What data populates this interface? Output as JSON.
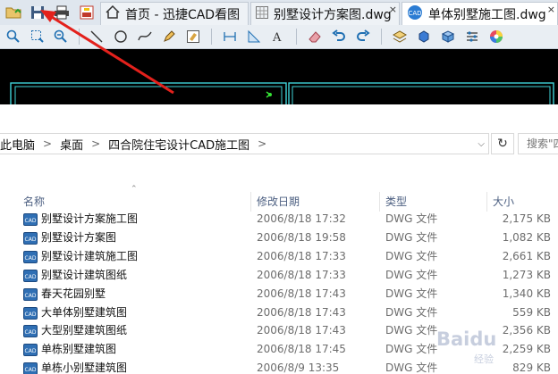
{
  "cad": {
    "tabs": [
      {
        "label": "首页 - 迅捷CAD看图",
        "icon": "home-icon",
        "close": ""
      },
      {
        "label": "别墅设计方案图.dwg",
        "icon": "drawing-grid-icon",
        "close": "×"
      },
      {
        "label": "单体别墅施工图.dwg",
        "icon": "cad-file-icon",
        "close": "×"
      }
    ],
    "quick_buttons": [
      "open-file-icon",
      "save-icon",
      "print-icon",
      "export-pdf-icon"
    ],
    "tools": [
      "zoom-in-icon",
      "zoom-window-icon",
      "zoom-extents-icon",
      "line-icon",
      "circle-icon",
      "spline-icon",
      "pencil-icon",
      "text-edit-icon",
      "dimension-icon",
      "area-measure-icon",
      "text-style-icon",
      "eraser-icon",
      "undo-icon",
      "redo-icon",
      "layer-icon",
      "3d-view-icon",
      "block-icon",
      "properties-icon",
      "color-wheel-icon"
    ]
  },
  "explorer": {
    "breadcrumb": [
      "此电脑",
      "桌面",
      "四合院住宅设计CAD施工图"
    ],
    "search_placeholder": "搜索\"四",
    "columns": {
      "name": "名称",
      "date": "修改日期",
      "type": "类型",
      "size": "大小"
    },
    "files": [
      {
        "name": "别墅设计方案施工图",
        "date": "2006/8/18 17:32",
        "type": "DWG 文件",
        "size": "2,175 KB"
      },
      {
        "name": "别墅设计方案图",
        "date": "2006/8/18 19:58",
        "type": "DWG 文件",
        "size": "1,082 KB"
      },
      {
        "name": "别墅设计建筑施工图",
        "date": "2006/8/18 17:33",
        "type": "DWG 文件",
        "size": "2,661 KB"
      },
      {
        "name": "别墅设计建筑图纸",
        "date": "2006/8/18 17:33",
        "type": "DWG 文件",
        "size": "1,273 KB"
      },
      {
        "name": "春天花园别墅",
        "date": "2006/8/18 17:43",
        "type": "DWG 文件",
        "size": "1,340 KB"
      },
      {
        "name": "大单体别墅建筑图",
        "date": "2006/8/18 17:43",
        "type": "DWG 文件",
        "size": "559 KB"
      },
      {
        "name": "大型别墅建筑图纸",
        "date": "2006/8/18 17:43",
        "type": "DWG 文件",
        "size": "2,356 KB"
      },
      {
        "name": "单栋别墅建筑图",
        "date": "2006/8/18 17:45",
        "type": "DWG 文件",
        "size": "2,259 KB"
      },
      {
        "name": "单栋小别墅建筑图",
        "date": "2006/8/9 13:35",
        "type": "DWG 文件",
        "size": "829 KB"
      }
    ]
  },
  "watermark": {
    "brand": "Baidu",
    "sub": "经验"
  },
  "colors": {
    "accent_arrow": "#e3211c",
    "canvas_bg": "#000000",
    "cad_line": "#3fd3d9"
  }
}
